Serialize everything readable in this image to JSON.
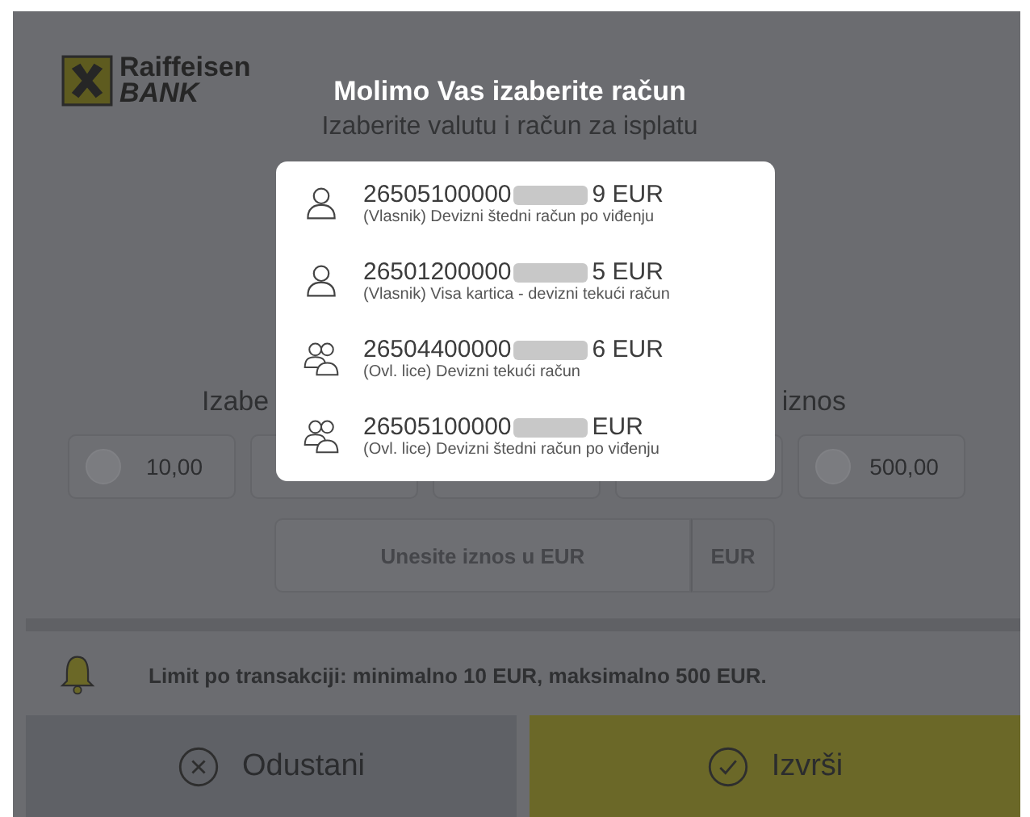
{
  "logo": {
    "line1": "Raiffeisen",
    "line2": "BANK"
  },
  "dialog": {
    "title": "Molimo Vas izaberite račun",
    "subtitle": "Izaberite valutu i račun za isplatu",
    "accounts": [
      {
        "kind": "owner",
        "number_start": "26505100000",
        "number_end": "9 EUR",
        "description": "(Vlasnik) Devizni štedni račun po viđenju"
      },
      {
        "kind": "owner",
        "number_start": "26501200000",
        "number_end": "5 EUR",
        "description": "(Vlasnik) Visa kartica - devizni tekući račun"
      },
      {
        "kind": "authorized",
        "number_start": "26504400000",
        "number_end": "6 EUR",
        "description": "(Ovl. lice) Devizni tekući račun"
      },
      {
        "kind": "authorized",
        "number_start": "26505100000",
        "number_end": "EUR",
        "description": "(Ovl. lice) Devizni štedni račun po viđenju"
      }
    ]
  },
  "amount": {
    "label_start": "Izabe",
    "label_end": "iznos",
    "options": [
      {
        "label": "10,00",
        "selected": false
      },
      {
        "label": "500,00",
        "selected": false
      }
    ],
    "input": {
      "placeholder": "Unesite iznos u EUR",
      "currency": "EUR"
    }
  },
  "limit": "Limit po transakciji: minimalno 10 EUR, maksimalno 500 EUR.",
  "buttons": {
    "cancel": "Odustani",
    "confirm": "Izvrši"
  }
}
